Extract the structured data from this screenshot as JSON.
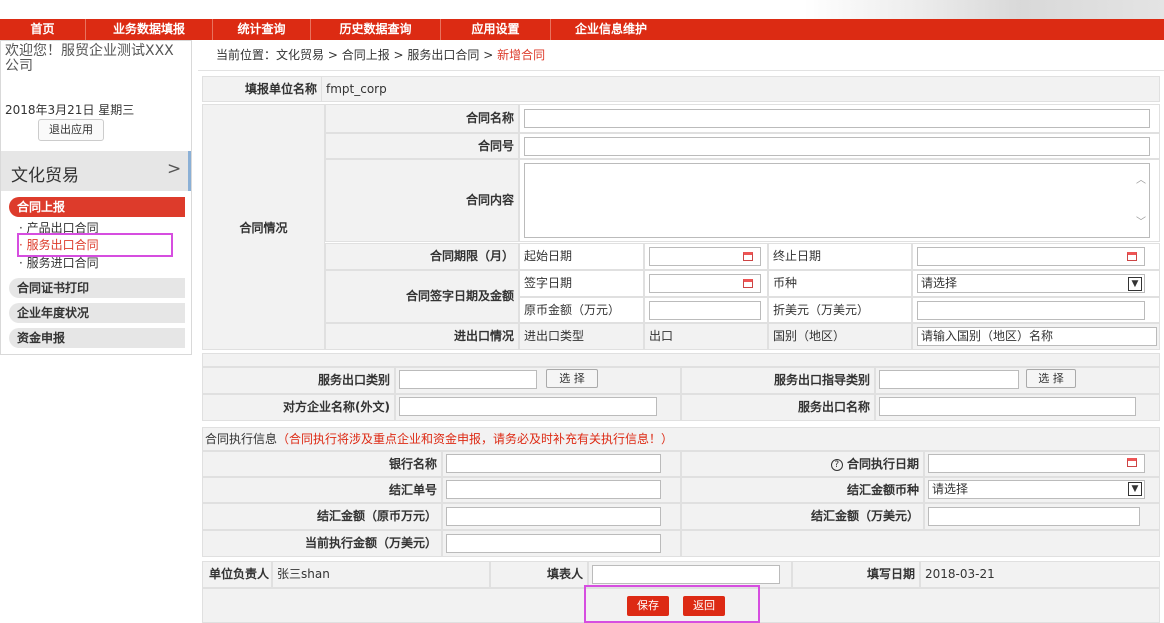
{
  "nav": {
    "items": [
      "首页",
      "业务数据填报",
      "统计查询",
      "历史数据查询",
      "应用设置",
      "企业信息维护"
    ]
  },
  "sidebar": {
    "welcome": "欢迎您！服贸企业测试XXX公司",
    "date": "2018年3月21日 星期三",
    "logout": "退出应用",
    "section": "文化贸易",
    "section_arrow": ">",
    "menu_active": "合同上报",
    "sub_items": [
      "· 产品出口合同",
      "· 服务出口合同",
      "· 服务进口合同"
    ],
    "menu_items": [
      "合同证书打印",
      "企业年度状况",
      "资金申报"
    ]
  },
  "breadcrumb": {
    "prefix": "当前位置：",
    "path": "文化贸易 > 合同上报 > 服务出口合同 > ",
    "current": "新增合同"
  },
  "form": {
    "unit_label": "填报单位名称",
    "unit_value": "fmpt_corp",
    "contract_section": "合同情况",
    "name_label": "合同名称",
    "no_label": "合同号",
    "content_label": "合同内容",
    "period_label": "合同期限（月）",
    "start_label": "起始日期",
    "end_label": "终止日期",
    "sign_label": "合同签字日期及金额",
    "sign_date_label": "签字日期",
    "currency_label": "币种",
    "currency_value": "请选择",
    "orig_amount_label": "原币金额（万元）",
    "usd_label": "折美元（万美元）",
    "trade_label": "进出口情况",
    "trade_type_label": "进出口类型",
    "trade_type_value": "出口",
    "country_label": "国别（地区）",
    "country_placeholder": "请输入国别（地区）名称",
    "service_type_label": "服务出口类别",
    "select_btn": "选 择",
    "guide_type_label": "服务出口指导类别",
    "partner_label": "对方企业名称(外文)",
    "service_name_label": "服务出口名称"
  },
  "exec": {
    "title_prefix": "合同执行信息",
    "title_note": "（合同执行将涉及重点企业和资金申报，请务必及时补充有关执行信息！）",
    "bank_label": "银行名称",
    "exec_date_label": "合同执行日期",
    "help_icon": "?",
    "settle_no_label": "结汇单号",
    "settle_currency_label": "结汇金额币种",
    "settle_currency_value": "请选择",
    "settle_orig_label": "结汇金额（原币万元）",
    "settle_usd_label": "结汇金额（万美元）",
    "current_amount_label": "当前执行金额（万美元）"
  },
  "footer": {
    "principal_label": "单位负责人",
    "principal_value": "张三shan",
    "filler_label": "填表人",
    "fill_date_label": "填写日期",
    "fill_date_value": "2018-03-21"
  },
  "actions": {
    "save": "保存",
    "back": "返回"
  },
  "colors": {
    "brand": "#dc2b13",
    "highlight": "#d64ee0"
  }
}
